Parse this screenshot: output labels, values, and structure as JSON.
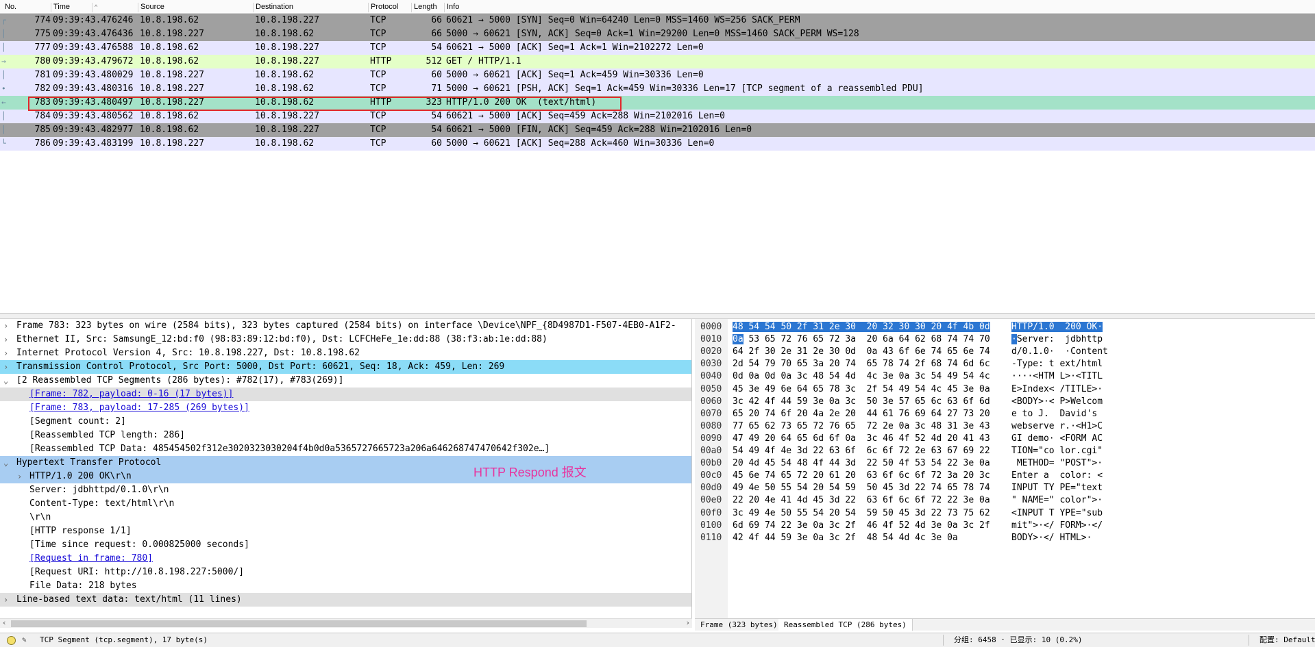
{
  "columns": [
    "No.",
    "Time",
    "Source",
    "Destination",
    "Protocol",
    "Length",
    "Info"
  ],
  "packets": [
    {
      "no": "774",
      "time": "09:39:43.476246",
      "src": "10.8.198.62",
      "dst": "10.8.198.227",
      "proto": "TCP",
      "len": "66",
      "info": "60621 → 5000 [SYN] Seq=0 Win=64240 Len=0 MSS=1460 WS=256 SACK_PERM",
      "bg": "#a0a0a0",
      "mark": "┌"
    },
    {
      "no": "775",
      "time": "09:39:43.476436",
      "src": "10.8.198.227",
      "dst": "10.8.198.62",
      "proto": "TCP",
      "len": "66",
      "info": "5000 → 60621 [SYN, ACK] Seq=0 Ack=1 Win=29200 Len=0 MSS=1460 SACK_PERM WS=128",
      "bg": "#a0a0a0",
      "mark": "│"
    },
    {
      "no": "777",
      "time": "09:39:43.476588",
      "src": "10.8.198.62",
      "dst": "10.8.198.227",
      "proto": "TCP",
      "len": "54",
      "info": "60621 → 5000 [ACK] Seq=1 Ack=1 Win=2102272 Len=0",
      "bg": "#e7e6ff",
      "mark": "│"
    },
    {
      "no": "780",
      "time": "09:39:43.479672",
      "src": "10.8.198.62",
      "dst": "10.8.198.227",
      "proto": "HTTP",
      "len": "512",
      "info": "GET / HTTP/1.1",
      "bg": "#e4ffc7",
      "mark": "→"
    },
    {
      "no": "781",
      "time": "09:39:43.480029",
      "src": "10.8.198.227",
      "dst": "10.8.198.62",
      "proto": "TCP",
      "len": "60",
      "info": "5000 → 60621 [ACK] Seq=1 Ack=459 Win=30336 Len=0",
      "bg": "#e7e6ff",
      "mark": "│"
    },
    {
      "no": "782",
      "time": "09:39:43.480316",
      "src": "10.8.198.227",
      "dst": "10.8.198.62",
      "proto": "TCP",
      "len": "71",
      "info": "5000 → 60621 [PSH, ACK] Seq=1 Ack=459 Win=30336 Len=17 [TCP segment of a reassembled PDU]",
      "bg": "#e7e6ff",
      "mark": "•"
    },
    {
      "no": "783",
      "time": "09:39:43.480497",
      "src": "10.8.198.227",
      "dst": "10.8.198.62",
      "proto": "HTTP",
      "len": "323",
      "info": "HTTP/1.0 200 OK  (text/html)",
      "bg": "#a4e2c8",
      "mark": "←"
    },
    {
      "no": "784",
      "time": "09:39:43.480562",
      "src": "10.8.198.62",
      "dst": "10.8.198.227",
      "proto": "TCP",
      "len": "54",
      "info": "60621 → 5000 [ACK] Seq=459 Ack=288 Win=2102016 Len=0",
      "bg": "#e7e6ff",
      "mark": "│"
    },
    {
      "no": "785",
      "time": "09:39:43.482977",
      "src": "10.8.198.62",
      "dst": "10.8.198.227",
      "proto": "TCP",
      "len": "54",
      "info": "60621 → 5000 [FIN, ACK] Seq=459 Ack=288 Win=2102016 Len=0",
      "bg": "#a0a0a0",
      "mark": "│"
    },
    {
      "no": "786",
      "time": "09:39:43.483199",
      "src": "10.8.198.227",
      "dst": "10.8.198.62",
      "proto": "TCP",
      "len": "60",
      "info": "5000 → 60621 [ACK] Seq=288 Ack=460 Win=30336 Len=0",
      "bg": "#e7e6ff",
      "mark": "└"
    }
  ],
  "details": [
    {
      "level": 0,
      "arrow": "›",
      "text": "Frame 783: 323 bytes on wire (2584 bits), 323 bytes captured (2584 bits) on interface \\Device\\NPF_{8D4987D1-F507-4EB0-A1F2-",
      "style": ""
    },
    {
      "level": 0,
      "arrow": "›",
      "text": "Ethernet II, Src: SamsungE_12:bd:f0 (98:83:89:12:bd:f0), Dst: LCFCHeFe_1e:dd:88 (38:f3:ab:1e:dd:88)",
      "style": ""
    },
    {
      "level": 0,
      "arrow": "›",
      "text": "Internet Protocol Version 4, Src: 10.8.198.227, Dst: 10.8.198.62",
      "style": ""
    },
    {
      "level": 0,
      "arrow": "›",
      "text": "Transmission Control Protocol, Src Port: 5000, Dst Port: 60621, Seq: 18, Ack: 459, Len: 269",
      "style": "hl-blue"
    },
    {
      "level": 0,
      "arrow": "⌄",
      "text": "[2 Reassembled TCP Segments (286 bytes): #782(17), #783(269)]",
      "style": ""
    },
    {
      "level": 1,
      "arrow": "",
      "text": "[Frame: 782, payload: 0-16 (17 bytes)]",
      "style": "link hl-grey"
    },
    {
      "level": 1,
      "arrow": "",
      "text": "[Frame: 783, payload: 17-285 (269 bytes)]",
      "style": "link"
    },
    {
      "level": 1,
      "arrow": "",
      "text": "[Segment count: 2]",
      "style": ""
    },
    {
      "level": 1,
      "arrow": "",
      "text": "[Reassembled TCP length: 286]",
      "style": ""
    },
    {
      "level": 1,
      "arrow": "",
      "text": "[Reassembled TCP Data: 485454502f312e3020323030204f4b0d0a5365727665723a206a646268747470642f302e…]",
      "style": ""
    },
    {
      "level": 0,
      "arrow": "⌄",
      "text": "Hypertext Transfer Protocol",
      "style": "hl-sel"
    },
    {
      "level": 1,
      "arrow": "›",
      "text": "HTTP/1.0 200 OK\\r\\n",
      "style": "hl-sel"
    },
    {
      "level": 1,
      "arrow": "",
      "text": "Server: jdbhttpd/0.1.0\\r\\n",
      "style": ""
    },
    {
      "level": 1,
      "arrow": "",
      "text": "Content-Type: text/html\\r\\n",
      "style": ""
    },
    {
      "level": 1,
      "arrow": "",
      "text": "\\r\\n",
      "style": ""
    },
    {
      "level": 1,
      "arrow": "",
      "text": "[HTTP response 1/1]",
      "style": ""
    },
    {
      "level": 1,
      "arrow": "",
      "text": "[Time since request: 0.000825000 seconds]",
      "style": ""
    },
    {
      "level": 1,
      "arrow": "",
      "text": "[Request in frame: 780]",
      "style": "link"
    },
    {
      "level": 1,
      "arrow": "",
      "text": "[Request URI: http://10.8.198.227:5000/]",
      "style": ""
    },
    {
      "level": 1,
      "arrow": "",
      "text": "File Data: 218 bytes",
      "style": ""
    },
    {
      "level": 0,
      "arrow": "›",
      "text": "Line-based text data: text/html (11 lines)",
      "style": "hl-grey"
    }
  ],
  "annotation": "HTTP Respond 报文",
  "hex": [
    {
      "off": "0000",
      "sel_bytes": "48 54 54 50 2f 31 2e 30  20 32 30 30 20 4f 4b 0d",
      "bytes": "",
      "sel_ascii": "HTTP/1.0  200 OK·",
      "ascii": ""
    },
    {
      "off": "0010",
      "sel_bytes": "0a",
      "bytes": " 53 65 72 76 65 72 3a  20 6a 64 62 68 74 74 70",
      "sel_ascii": "·",
      "ascii": "Server:  jdbhttp"
    },
    {
      "off": "0020",
      "sel_bytes": "",
      "bytes": "64 2f 30 2e 31 2e 30 0d  0a 43 6f 6e 74 65 6e 74",
      "sel_ascii": "",
      "ascii": "d/0.1.0·  ·Content"
    },
    {
      "off": "0030",
      "sel_bytes": "",
      "bytes": "2d 54 79 70 65 3a 20 74  65 78 74 2f 68 74 6d 6c",
      "sel_ascii": "",
      "ascii": "-Type: t ext/html"
    },
    {
      "off": "0040",
      "sel_bytes": "",
      "bytes": "0d 0a 0d 0a 3c 48 54 4d  4c 3e 0a 3c 54 49 54 4c",
      "sel_ascii": "",
      "ascii": "····<HTM L>·<TITL"
    },
    {
      "off": "0050",
      "sel_bytes": "",
      "bytes": "45 3e 49 6e 64 65 78 3c  2f 54 49 54 4c 45 3e 0a",
      "sel_ascii": "",
      "ascii": "E>Index< /TITLE>·"
    },
    {
      "off": "0060",
      "sel_bytes": "",
      "bytes": "3c 42 4f 44 59 3e 0a 3c  50 3e 57 65 6c 63 6f 6d",
      "sel_ascii": "",
      "ascii": "<BODY>·< P>Welcom"
    },
    {
      "off": "0070",
      "sel_bytes": "",
      "bytes": "65 20 74 6f 20 4a 2e 20  44 61 76 69 64 27 73 20",
      "sel_ascii": "",
      "ascii": "e to J.  David's "
    },
    {
      "off": "0080",
      "sel_bytes": "",
      "bytes": "77 65 62 73 65 72 76 65  72 2e 0a 3c 48 31 3e 43",
      "sel_ascii": "",
      "ascii": "webserve r.·<H1>C"
    },
    {
      "off": "0090",
      "sel_bytes": "",
      "bytes": "47 49 20 64 65 6d 6f 0a  3c 46 4f 52 4d 20 41 43",
      "sel_ascii": "",
      "ascii": "GI demo· <FORM AC"
    },
    {
      "off": "00a0",
      "sel_bytes": "",
      "bytes": "54 49 4f 4e 3d 22 63 6f  6c 6f 72 2e 63 67 69 22",
      "sel_ascii": "",
      "ascii": "TION=\"co lor.cgi\""
    },
    {
      "off": "00b0",
      "sel_bytes": "",
      "bytes": "20 4d 45 54 48 4f 44 3d  22 50 4f 53 54 22 3e 0a",
      "sel_ascii": "",
      "ascii": " METHOD= \"POST\">·"
    },
    {
      "off": "00c0",
      "sel_bytes": "",
      "bytes": "45 6e 74 65 72 20 61 20  63 6f 6c 6f 72 3a 20 3c",
      "sel_ascii": "",
      "ascii": "Enter a  color: <"
    },
    {
      "off": "00d0",
      "sel_bytes": "",
      "bytes": "49 4e 50 55 54 20 54 59  50 45 3d 22 74 65 78 74",
      "sel_ascii": "",
      "ascii": "INPUT TY PE=\"text"
    },
    {
      "off": "00e0",
      "sel_bytes": "",
      "bytes": "22 20 4e 41 4d 45 3d 22  63 6f 6c 6f 72 22 3e 0a",
      "sel_ascii": "",
      "ascii": "\" NAME=\" color\">·"
    },
    {
      "off": "00f0",
      "sel_bytes": "",
      "bytes": "3c 49 4e 50 55 54 20 54  59 50 45 3d 22 73 75 62",
      "sel_ascii": "",
      "ascii": "<INPUT T YPE=\"sub"
    },
    {
      "off": "0100",
      "sel_bytes": "",
      "bytes": "6d 69 74 22 3e 0a 3c 2f  46 4f 52 4d 3e 0a 3c 2f",
      "sel_ascii": "",
      "ascii": "mit\">·</ FORM>·</"
    },
    {
      "off": "0110",
      "sel_bytes": "",
      "bytes": "42 4f 44 59 3e 0a 3c 2f  48 54 4d 4c 3e 0a",
      "sel_ascii": "",
      "ascii": "BODY>·</ HTML>·"
    }
  ],
  "hex_tabs": [
    "Frame (323 bytes)",
    "Reassembled TCP (286 bytes)"
  ],
  "status": {
    "field": "TCP Segment (tcp.segment), 17 byte(s)",
    "packets": "分组: 6458 · 已显示: 10 (0.2%)",
    "profile": "配置: Default"
  }
}
